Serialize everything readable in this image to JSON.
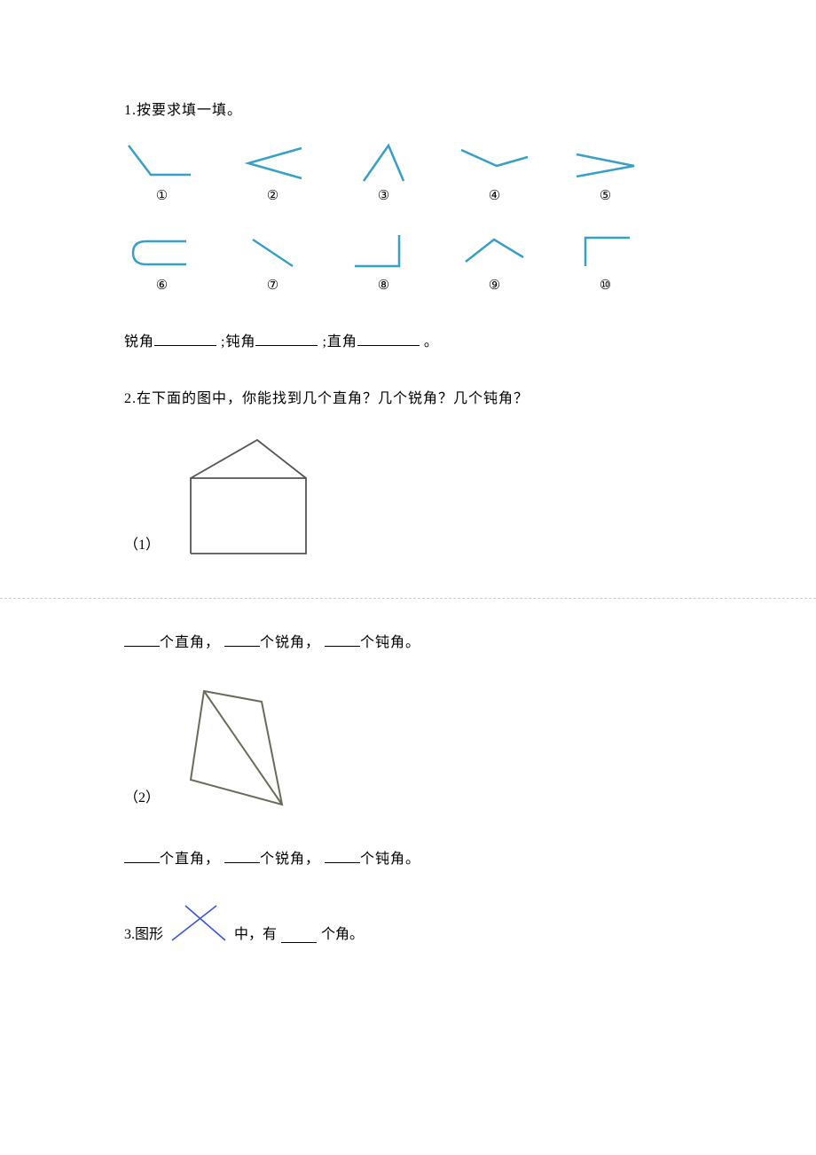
{
  "q1": {
    "prompt": "1.按要求填一填。",
    "labels": [
      "①",
      "②",
      "③",
      "④",
      "⑤",
      "⑥",
      "⑦",
      "⑧",
      "⑨",
      "⑩"
    ],
    "fill_acute": "锐角",
    "fill_obtuse": ";钝角",
    "fill_right": ";直角",
    "period": "。"
  },
  "q2": {
    "prompt": "2.在下面的图中，你能找到几个直角？几个锐角？几个钝角？",
    "sub1": "（1）",
    "sub2": "（2）",
    "t_right": "个直角，",
    "t_acute": "个锐角，",
    "t_obtuse": "个钝角。"
  },
  "q3": {
    "prefix": "3.图形",
    "mid": "中，有",
    "suffix": "个角。"
  }
}
